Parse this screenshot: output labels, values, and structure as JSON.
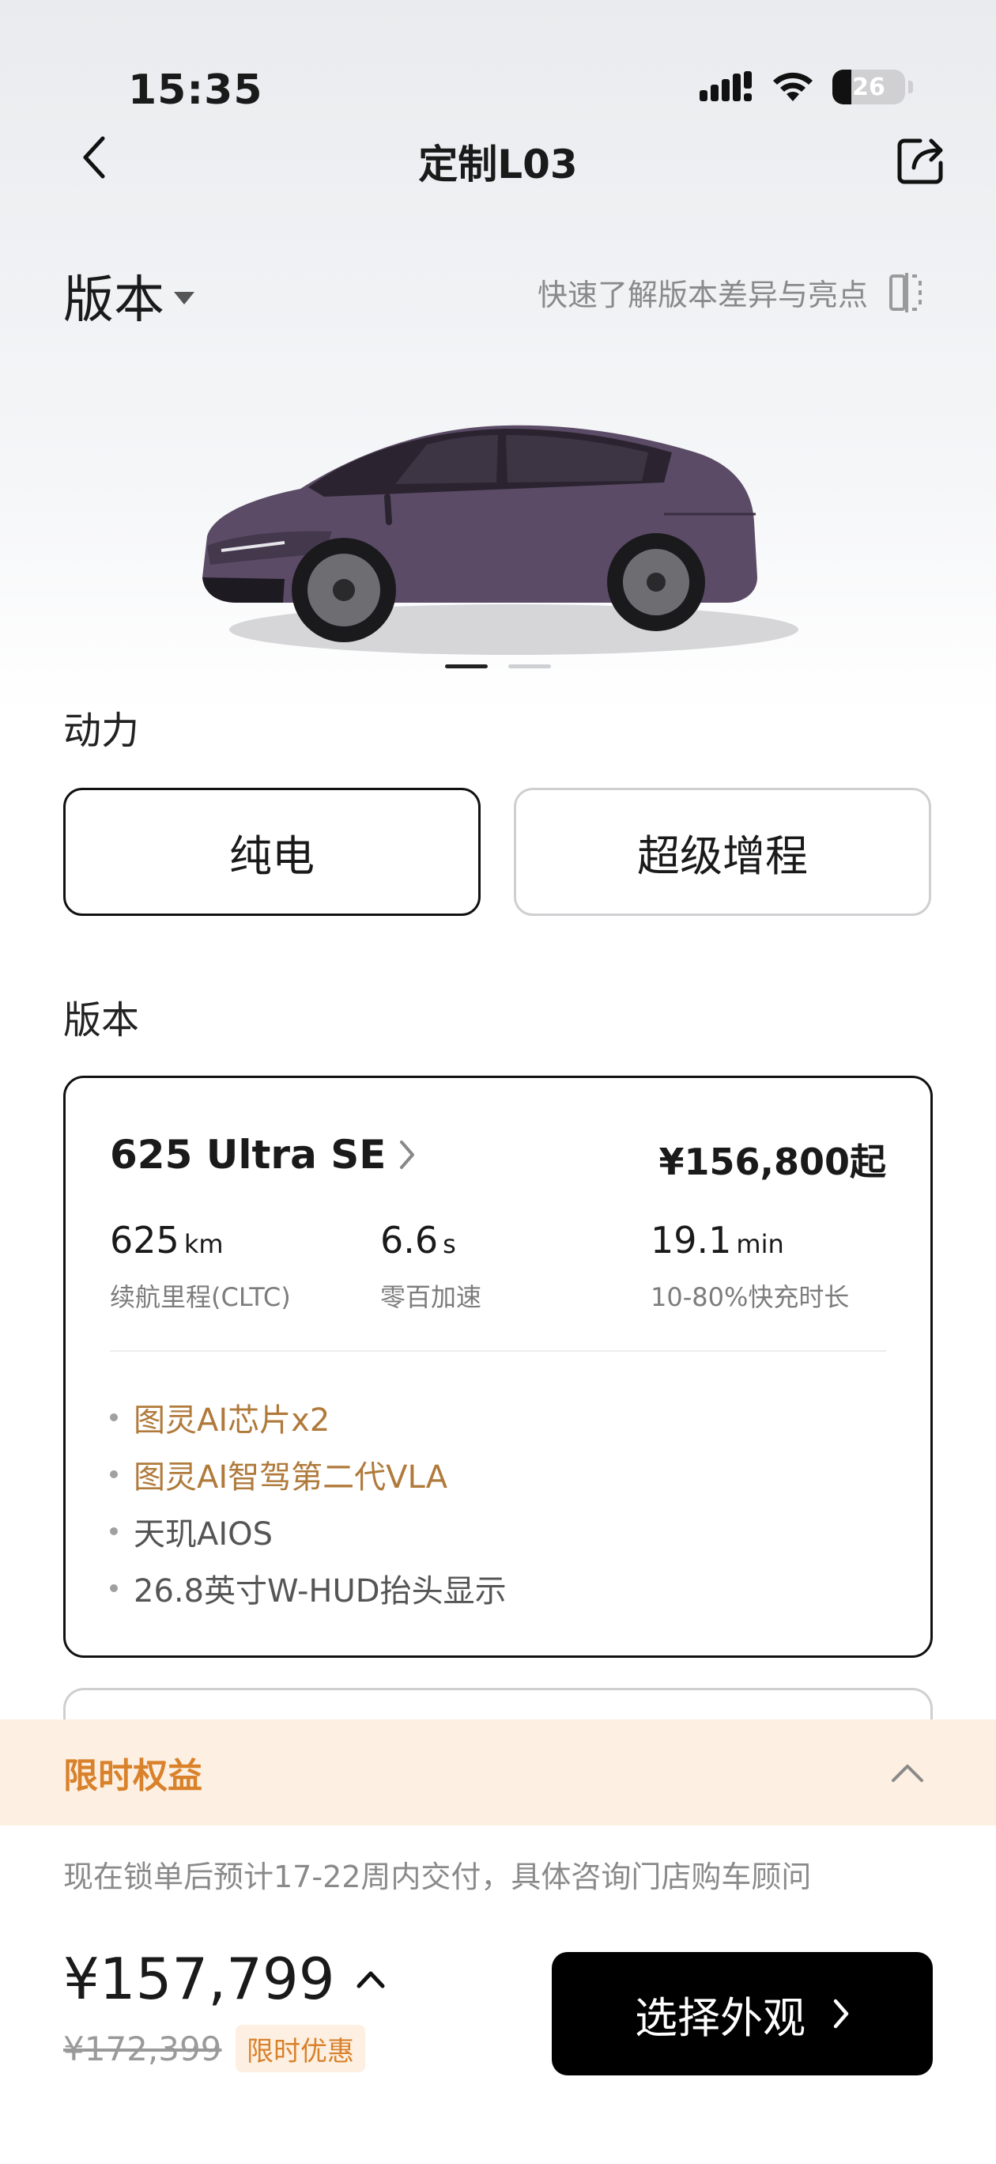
{
  "status_bar": {
    "time": "15:35",
    "battery": "26",
    "battery_level": 0.26,
    "icons": [
      "signal-icon",
      "wifi-icon",
      "battery-icon"
    ]
  },
  "nav": {
    "title": "定制L03",
    "back_icon": "chevron-left-icon",
    "share_icon": "share-icon"
  },
  "version_header": {
    "label": "版本",
    "compare_link": "快速了解版本差异与亮点",
    "compare_icon": "compare-icon"
  },
  "car": {
    "carousel_count": 2,
    "carousel_active": 1,
    "color": "#5a4a63"
  },
  "power": {
    "label": "动力",
    "options": [
      {
        "label": "纯电",
        "selected": true
      },
      {
        "label": "超级增程",
        "selected": false
      }
    ]
  },
  "versions": {
    "label": "版本",
    "selected": {
      "name": "625 Ultra SE",
      "price": "¥156,800起",
      "specs": [
        {
          "value": "625",
          "unit": "km",
          "label": "续航里程(CLTC)"
        },
        {
          "value": "6.6",
          "unit": "s",
          "label": "零百加速"
        },
        {
          "value": "19.1",
          "unit": "min",
          "label": "10-80%快充时长"
        }
      ],
      "features": [
        {
          "text": "图灵AI芯片x2",
          "highlight": true
        },
        {
          "text": "图灵AI智驾第二代VLA",
          "highlight": true
        },
        {
          "text": "天玑AIOS",
          "highlight": false
        },
        {
          "text": "26.8英寸W-HUD抬头显示",
          "highlight": false
        }
      ]
    }
  },
  "benefits": {
    "title": "限时权益",
    "toggle_icon": "chevron-up-icon"
  },
  "delivery_note": "现在锁单后预计17-22周内交付，具体咨询门店购车顾问",
  "pricing": {
    "current": "¥157,799",
    "original": "¥172,399",
    "promo_badge": "限时优惠"
  },
  "cta": {
    "label": "选择外观"
  },
  "colors": {
    "accent": "#d9812b",
    "highlight_text": "#b07a3b",
    "benefit_bg": "#fdf0e2",
    "cta_bg": "#000000"
  }
}
